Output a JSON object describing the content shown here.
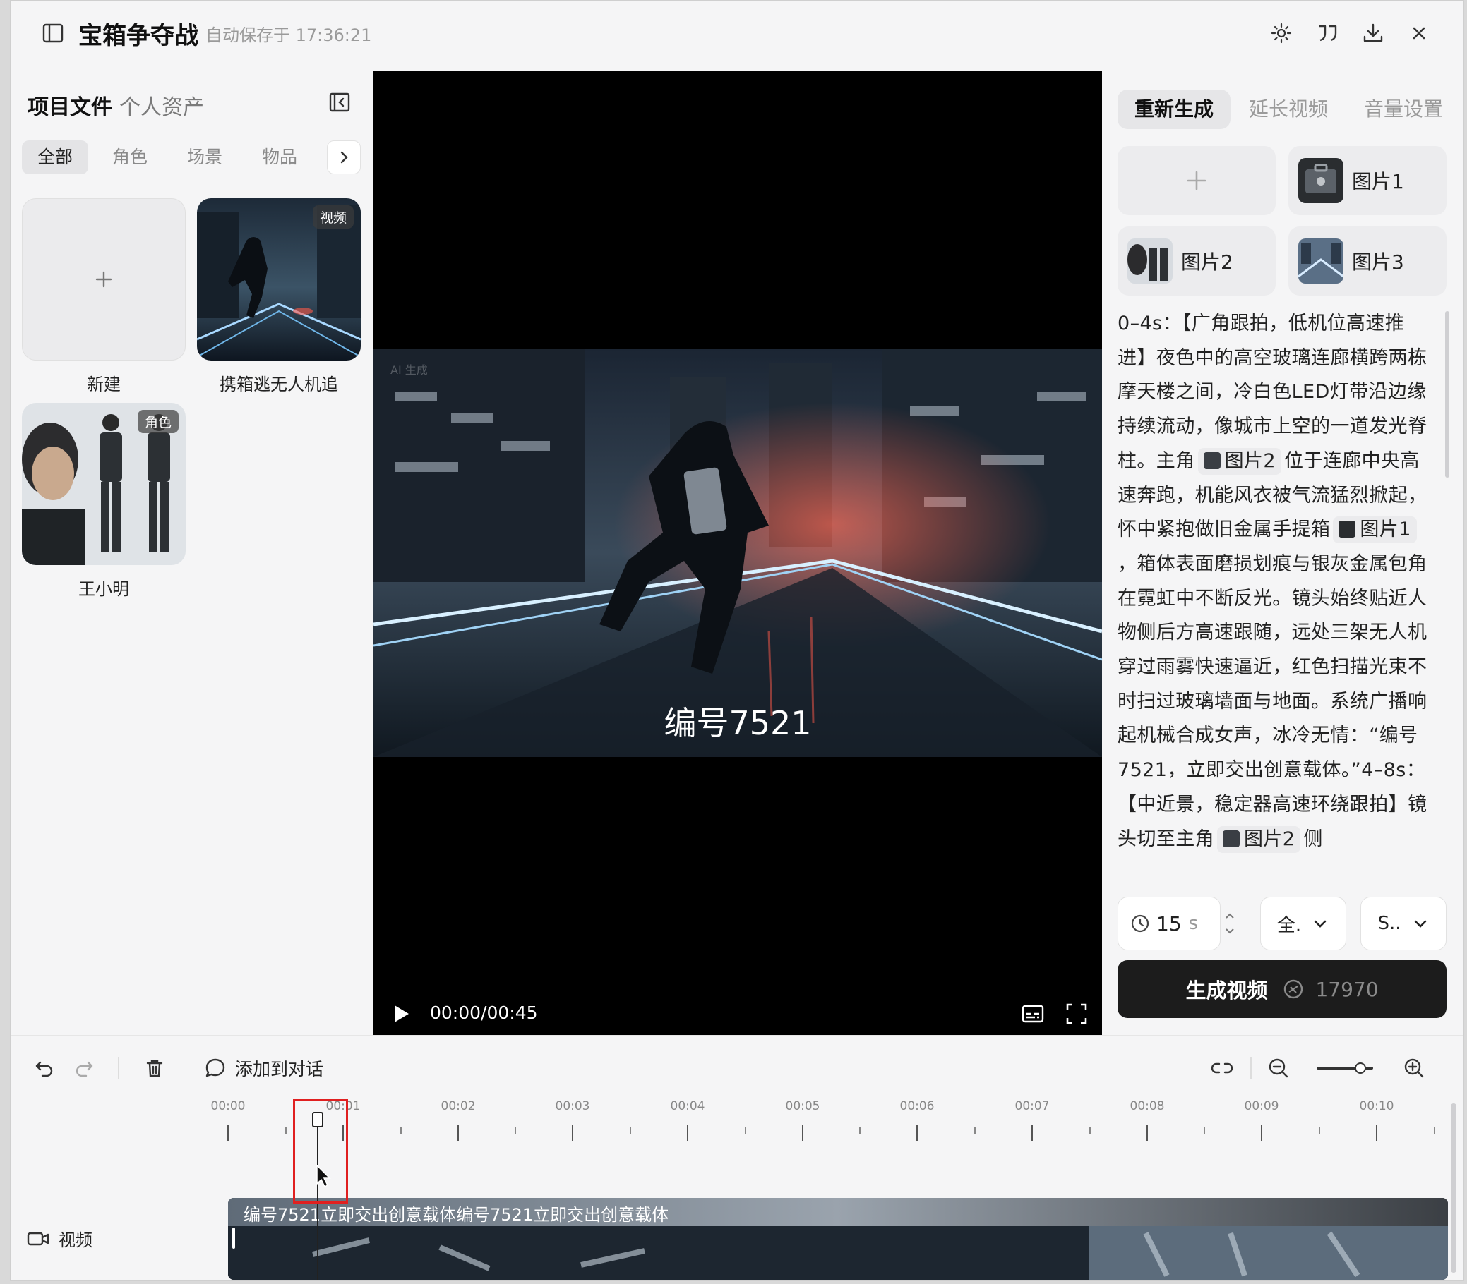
{
  "header": {
    "title": "宝箱争夺战",
    "autosave": "自动保存于 17:36:21"
  },
  "left_panel": {
    "tabs": [
      "项目文件",
      "个人资产"
    ],
    "filters": [
      "全部",
      "角色",
      "场景",
      "物品"
    ],
    "assets": [
      {
        "label": "新建"
      },
      {
        "label": "携箱逃无人机追",
        "badge": "视频"
      },
      {
        "label": "王小明",
        "badge": "角色"
      }
    ]
  },
  "preview": {
    "subtitle": "编号7521",
    "watermark": "AI 生成",
    "timecode": "00:00/00:45"
  },
  "right_panel": {
    "tabs": [
      "重新生成",
      "延长视频",
      "音量设置"
    ],
    "refs": [
      "图片1",
      "图片2",
      "图片3"
    ],
    "prompt": {
      "p1": "0–4s：【广角跟拍，低机位高速推进】夜色中的高空玻璃连廊横跨两栋摩天楼之间，冷白色LED灯带沿边缘持续流动，像城市上空的一道发光脊柱。主角",
      "m1": "图片2",
      "p2": "位于连廊中央高速奔跑，机能风衣被气流猛烈掀起，怀中紧抱做旧金属手提箱",
      "m2": "图片1",
      "p3": "，箱体表面磨损划痕与银灰金属包角在霓虹中不断反光。镜头始终贴近人物侧后方高速跟随，远处三架无人机穿过雨雾快速逼近，红色扫描光束不时扫过玻璃墙面与地面。系统广播响起机械合成女声，冰冷无情：“编号7521，立即交出创意载体。”4–8s：【中近景，稳定器高速环绕跟拍】镜头切至主角",
      "m3": "图片2",
      "p4": "侧"
    },
    "duration_value": "15",
    "duration_unit": "s",
    "select1": "全.",
    "select2": "S..",
    "generate_label": "生成视频",
    "credits": "17970"
  },
  "timeline": {
    "add_dialog": "添加到对话",
    "ticks": [
      "00:00",
      "00:01",
      "00:02",
      "00:03",
      "00:04",
      "00:05",
      "00:06",
      "00:07",
      "00:08",
      "00:09",
      "00:10"
    ],
    "track_label": "视频",
    "clip_caption": "编号7521立即交出创意载体编号7521立即交出创意载体"
  },
  "colors": {
    "accent_dark": "#1c1c1c",
    "highlight": "#e02020",
    "panel_bg": "#f5f5f6"
  }
}
